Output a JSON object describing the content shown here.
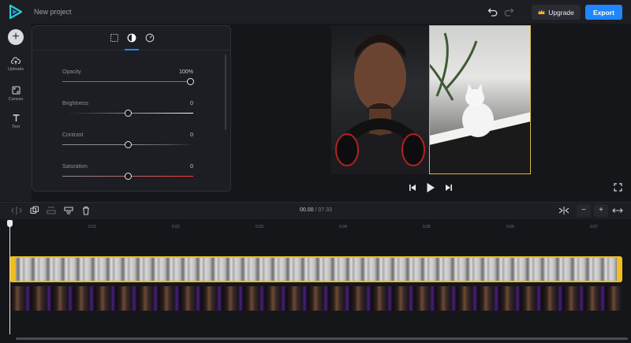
{
  "header": {
    "project_title": "New project",
    "upgrade_label": "Upgrade",
    "export_label": "Export",
    "accent_color": "#1f86ff"
  },
  "rail": {
    "add_icon": "plus-icon",
    "items": [
      {
        "label": "Uploads",
        "icon": "cloud-upload-icon"
      },
      {
        "label": "Canvas",
        "icon": "resize-icon"
      },
      {
        "label": "Text",
        "icon": "text-icon"
      }
    ]
  },
  "adjust_panel": {
    "tabs": [
      {
        "icon": "crop-icon",
        "active": false
      },
      {
        "icon": "contrast-icon",
        "active": true
      },
      {
        "icon": "speed-icon",
        "active": false
      }
    ],
    "sliders": [
      {
        "label": "Opacity",
        "value": "100%",
        "level": 1.0
      },
      {
        "label": "Brightness",
        "value": "0",
        "level": 0.5
      },
      {
        "label": "Contrast",
        "value": "0",
        "level": 0.5
      },
      {
        "label": "Saturation",
        "value": "0",
        "level": 0.5
      }
    ]
  },
  "timeline": {
    "current_time": "00.00",
    "separator": "/",
    "total_time": "07.33",
    "tick_labels": [
      "0.01",
      "0.02",
      "0.03",
      "0.04",
      "0.05",
      "0.06",
      "0.07"
    ],
    "zoom_out": "−",
    "zoom_in": "+"
  }
}
